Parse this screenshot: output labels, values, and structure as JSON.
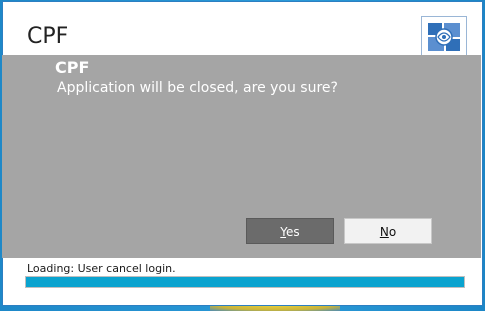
{
  "window": {
    "app_title": "CPF"
  },
  "dialog": {
    "title": "CPF",
    "message": "Application will be closed, are you sure?",
    "yes_accel": "Y",
    "yes_rest": "es",
    "no_accel": "N",
    "no_rest": "o"
  },
  "status": {
    "text": "Loading: User cancel login.",
    "progress": 1.0
  },
  "colors": {
    "overlay": "#a5a5a5",
    "progress": "#0aa3cf",
    "yes_button": "#6b6b6b",
    "no_button": "#f2f2f2"
  },
  "icons": {
    "logo": "cpf-logo-icon"
  }
}
